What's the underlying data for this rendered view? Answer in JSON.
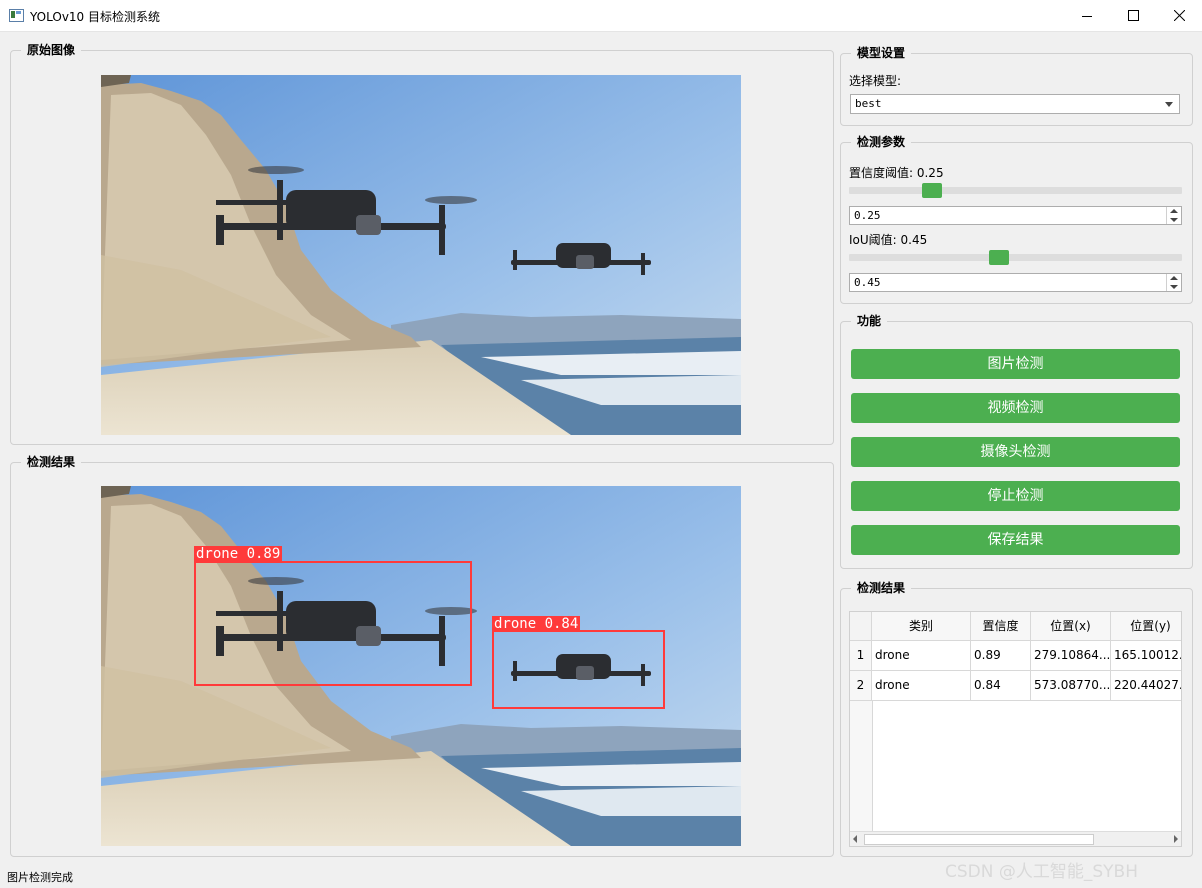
{
  "window": {
    "title": "YOLOv10 目标检测系统",
    "controls": [
      "minimize-icon",
      "maximize-icon",
      "close-icon"
    ]
  },
  "original_panel": {
    "title": "原始图像"
  },
  "result_panel": {
    "title": "检测结果",
    "detections": [
      {
        "label": "drone 0.89"
      },
      {
        "label": "drone 0.84"
      }
    ]
  },
  "model_settings": {
    "title": "模型设置",
    "select_label": "选择模型:",
    "selected_model": "best"
  },
  "detection_params": {
    "title": "检测参数",
    "confidence_label": "置信度阈值: 0.25",
    "confidence_value": "0.25",
    "confidence_level": 0.25,
    "iou_label": "IoU阈值: 0.45",
    "iou_value": "0.45",
    "iou_level": 0.45
  },
  "functions": {
    "title": "功能",
    "buttons": [
      "图片检测",
      "视频检测",
      "摄像头检测",
      "停止检测",
      "保存结果"
    ]
  },
  "results_table": {
    "title": "检测结果",
    "headers": [
      "类别",
      "置信度",
      "位置(x)",
      "位置(y)"
    ],
    "rows": [
      {
        "index": "1",
        "cells": [
          "drone",
          "0.89",
          "279.10864...",
          "165.10012..."
        ]
      },
      {
        "index": "2",
        "cells": [
          "drone",
          "0.84",
          "573.08770...",
          "220.44027..."
        ]
      }
    ]
  },
  "status_bar": {
    "text": "图片检测完成"
  },
  "watermark": "CSDN @人工智能_SYBH",
  "colors": {
    "accent": "#4caf50",
    "detection_box": "#ff3a3a"
  }
}
